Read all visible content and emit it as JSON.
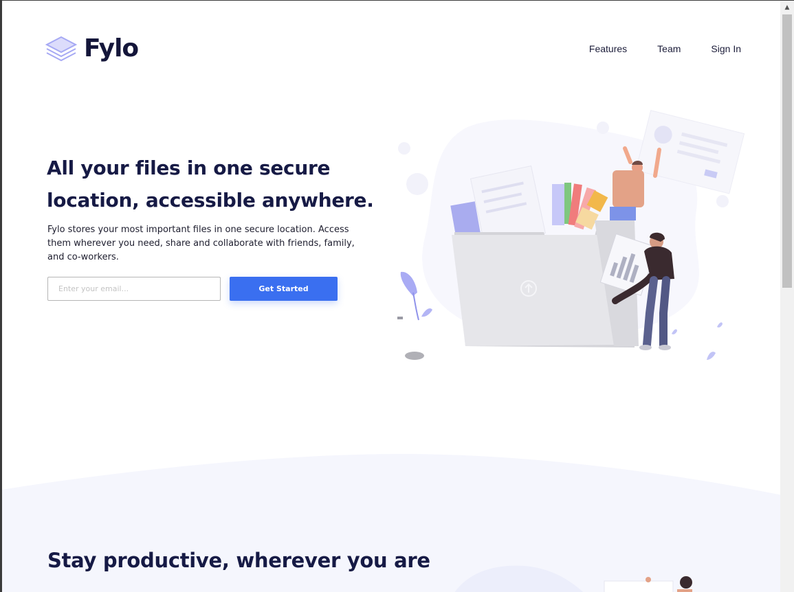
{
  "brand": {
    "name": "Fylo"
  },
  "nav": {
    "items": [
      "Features",
      "Team",
      "Sign In"
    ]
  },
  "hero": {
    "title_line1": "All your files in one secure",
    "title_line2": "location, accessible anywhere.",
    "description": "Fylo stores your most important files in one secure location. Access them wherever you need, share and collaborate with friends, family, and co-workers.",
    "email_placeholder": "Enter your email...",
    "cta_label": "Get Started"
  },
  "productive": {
    "title": "Stay productive, wherever you are"
  },
  "colors": {
    "primary_navy": "#161a45",
    "accent_blue": "#3a6ff0",
    "logo_lavender": "#a3a6f4",
    "section_bg": "#f5f6fd"
  },
  "icons": [
    "layers-logo-icon",
    "upload-icon",
    "scroll-up-arrow-icon"
  ]
}
